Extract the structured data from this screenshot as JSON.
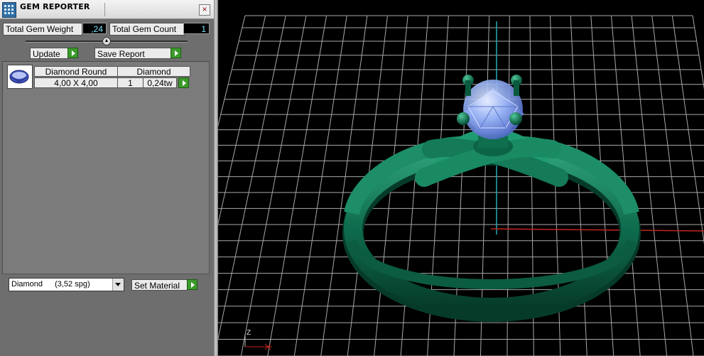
{
  "panel": {
    "title": "GEM REPORTER",
    "close_glyph": "×",
    "total_weight_label": "Total Gem Weight",
    "total_weight_value": ",24",
    "total_count_label": "Total Gem Count",
    "total_count_value": "1",
    "update_label": "Update",
    "save_report_label": "Save Report",
    "gem_rows": [
      {
        "shape": "Diamond Round",
        "size": "4,00 X 4,00",
        "material": "Diamond",
        "count": "1",
        "weight": "0,24tw"
      }
    ],
    "material_select": {
      "value": "Diamond",
      "detail": "(3,52 spg)"
    },
    "set_material_label": "Set Material"
  },
  "viewport": {
    "axis_label": "Z",
    "colors": {
      "grid": "#a8a8a8",
      "ring": "#0f6b4d",
      "gem": "#8aa8f0",
      "x_axis": "#c0261c",
      "z_axis": "#25a9b8"
    }
  },
  "icons": [
    "app-icon",
    "close-icon",
    "play-icon",
    "dropdown-arrow-icon",
    "gem-thumbnail-icon"
  ]
}
